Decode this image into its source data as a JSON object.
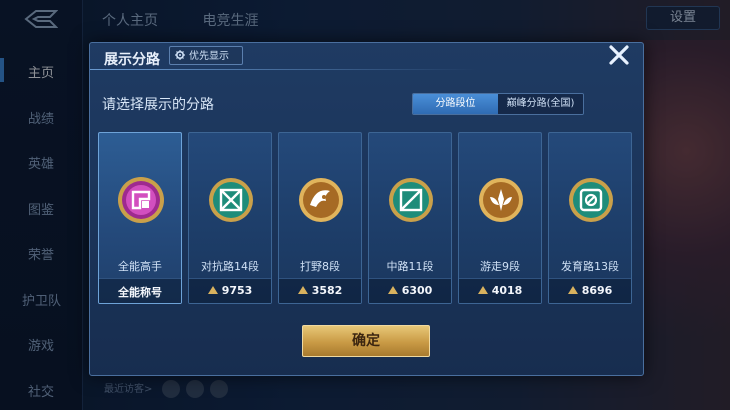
{
  "background": {
    "nav": [
      "主页",
      "战绩",
      "英雄",
      "图鉴",
      "荣誉",
      "护卫队",
      "游戏",
      "社交"
    ],
    "active_nav": "主页",
    "top_tabs": [
      "个人主页",
      "电竞生涯"
    ],
    "settings_label": "设置",
    "recent_visitors_label": "最近访客>"
  },
  "modal": {
    "title": "展示分路",
    "priority_label": "优先显示",
    "prompt": "请选择展示的分路",
    "tabs": [
      {
        "label": "分路段位",
        "selected": true
      },
      {
        "label": "巅峰分路(全国)",
        "selected": false
      }
    ],
    "cards": [
      {
        "rank": "全能高手",
        "score_text": "全能称号",
        "icon": "all-round-badge-icon",
        "selected": true
      },
      {
        "rank": "对抗路14段",
        "score": "9753",
        "icon": "clash-lane-badge-icon"
      },
      {
        "rank": "打野8段",
        "score": "3582",
        "icon": "jungle-badge-icon"
      },
      {
        "rank": "中路11段",
        "score": "6300",
        "icon": "mid-lane-badge-icon"
      },
      {
        "rank": "游走9段",
        "score": "4018",
        "icon": "roam-badge-icon"
      },
      {
        "rank": "发育路13段",
        "score": "8696",
        "icon": "farm-lane-badge-icon"
      }
    ],
    "confirm_label": "确定"
  },
  "colors": {
    "accent_blue": "#3f8fe0",
    "gold": "#c99a45",
    "modal_bg": "#1f3b63"
  }
}
